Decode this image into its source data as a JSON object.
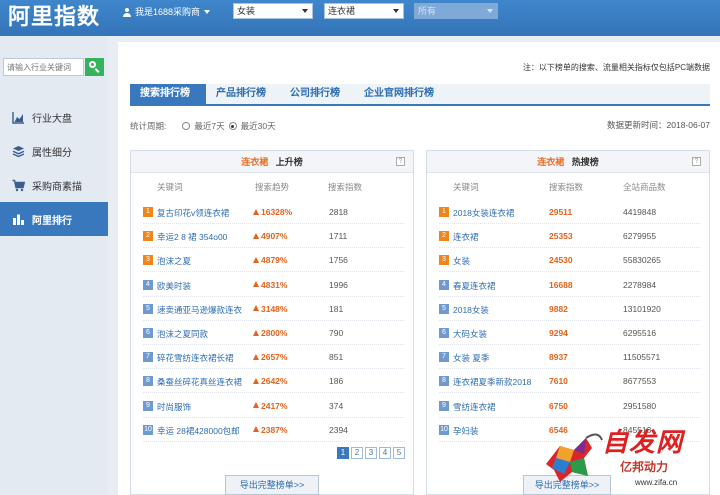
{
  "app": {
    "logo": "阿里指数"
  },
  "header": {
    "user_label": "我是1688采购商",
    "select_category": "女装",
    "select_subcategory": "连衣裙",
    "select_third": "所有"
  },
  "sidebar": {
    "search_placeholder": "请输入行业关键词",
    "items": [
      {
        "label": "行业大盘",
        "icon": "area-chart-icon"
      },
      {
        "label": "属性细分",
        "icon": "layers-icon"
      },
      {
        "label": "采购商素描",
        "icon": "cart-icon"
      },
      {
        "label": "阿里排行",
        "icon": "bar-chart-icon",
        "active": true
      }
    ]
  },
  "main": {
    "note": "注：以下榜单的搜索、流量相关指标仅包括PC端数据",
    "tabs": [
      "搜索排行榜",
      "产品排行榜",
      "公司排行榜",
      "企业官网排行榜"
    ],
    "period_label": "统计周期:",
    "period_options": [
      "最近7天",
      "最近30天"
    ],
    "period_selected": "最近30天",
    "updated": "数据更新时间：2018-06-07"
  },
  "rising": {
    "keyword": "连衣裙",
    "title": "上升榜",
    "columns": [
      "关键词",
      "搜索趋势",
      "搜索指数"
    ],
    "rows": [
      {
        "rank": "1",
        "kw": "复古印花v领连衣裙",
        "trend": "16328%",
        "index": "2818"
      },
      {
        "rank": "2",
        "kw": "幸运2 8 裙 354o00",
        "trend": "4907%",
        "index": "1711"
      },
      {
        "rank": "3",
        "kw": "泡沫之夏",
        "trend": "4879%",
        "index": "1756"
      },
      {
        "rank": "4",
        "kw": "欧美时装",
        "trend": "4831%",
        "index": "1996"
      },
      {
        "rank": "5",
        "kw": "速卖通亚马逊爆款连衣",
        "trend": "3148%",
        "index": "181"
      },
      {
        "rank": "6",
        "kw": "泡沫之夏同款",
        "trend": "2800%",
        "index": "790"
      },
      {
        "rank": "7",
        "kw": "碎花雪纺连衣裙长裙",
        "trend": "2657%",
        "index": "851"
      },
      {
        "rank": "8",
        "kw": "桑蚕丝碎花真丝连衣裙",
        "trend": "2642%",
        "index": "186"
      },
      {
        "rank": "9",
        "kw": "时尚服饰",
        "trend": "2417%",
        "index": "374"
      },
      {
        "rank": "10",
        "kw": "幸运 28裙428000包邮",
        "trend": "2387%",
        "index": "2394"
      }
    ],
    "pages": [
      "1",
      "2",
      "3",
      "4",
      "5"
    ],
    "export_label": "导出完整榜单>>"
  },
  "hot": {
    "keyword": "连衣裙",
    "title": "热搜榜",
    "columns": [
      "关键词",
      "搜索指数",
      "全站商品数"
    ],
    "rows": [
      {
        "rank": "1",
        "kw": "2018女装连衣裙",
        "index": "29511",
        "count": "4419848"
      },
      {
        "rank": "2",
        "kw": "连衣裙",
        "index": "25353",
        "count": "6279955"
      },
      {
        "rank": "3",
        "kw": "女装",
        "index": "24530",
        "count": "55830265"
      },
      {
        "rank": "4",
        "kw": "春夏连衣裙",
        "index": "16688",
        "count": "2278984"
      },
      {
        "rank": "5",
        "kw": "2018女装",
        "index": "9882",
        "count": "13101920"
      },
      {
        "rank": "6",
        "kw": "大码女装",
        "index": "9294",
        "count": "6295516"
      },
      {
        "rank": "7",
        "kw": "女装 夏季",
        "index": "8937",
        "count": "11505571"
      },
      {
        "rank": "8",
        "kw": "连衣裙夏季新款2018",
        "index": "7610",
        "count": "8677553"
      },
      {
        "rank": "9",
        "kw": "雪纺连衣裙",
        "index": "6750",
        "count": "2951580"
      },
      {
        "rank": "10",
        "kw": "孕妇装",
        "index": "6546",
        "count": "845513"
      }
    ],
    "export_label": "导出完整榜单>>"
  },
  "watermark": {
    "title": "自发网",
    "sub": "亿邦动力",
    "url": "www.zifa.cn"
  }
}
